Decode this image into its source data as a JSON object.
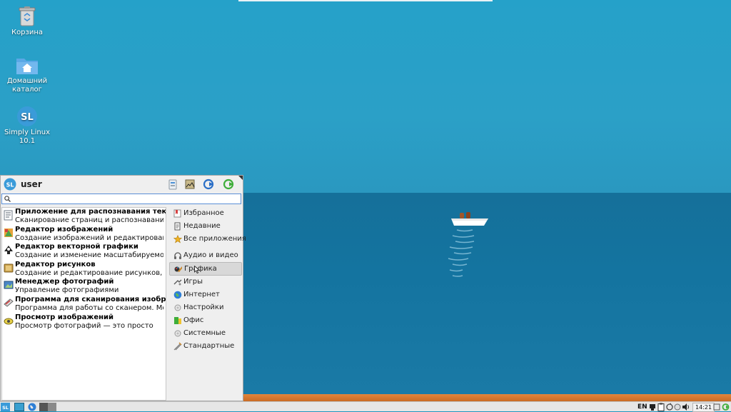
{
  "desktop": {
    "icons": [
      {
        "label": "Корзина"
      },
      {
        "label": "Домашний каталог"
      },
      {
        "label": "Simply Linux 10.1"
      }
    ]
  },
  "menu": {
    "username": "user",
    "search": {
      "value": "",
      "placeholder": ""
    },
    "apps": [
      {
        "title": "Приложение для распознавания текста",
        "desc": "Сканирование страниц и распознавание т..."
      },
      {
        "title": "Редактор изображений",
        "desc": "Создание изображений и редактировани..."
      },
      {
        "title": "Редактор векторной графики",
        "desc": "Создание и изменение масштабируемой в..."
      },
      {
        "title": "Редактор рисунков",
        "desc": "Создание и редактирование рисунков, бл..."
      },
      {
        "title": "Менеджер фотографий",
        "desc": "Управление фотографиями"
      },
      {
        "title": "Программа для сканирования изобра...",
        "desc": "Программа для работы со сканером. Мож..."
      },
      {
        "title": "Просмотр изображений",
        "desc": "Просмотр фотографий — это просто"
      }
    ],
    "categories": [
      {
        "label": "Избранное"
      },
      {
        "label": "Недавние"
      },
      {
        "label": "Все приложения"
      },
      {
        "label": "Аудио и видео"
      },
      {
        "label": "Графика"
      },
      {
        "label": "Игры"
      },
      {
        "label": "Интернет"
      },
      {
        "label": "Настройки"
      },
      {
        "label": "Офис"
      },
      {
        "label": "Системные"
      },
      {
        "label": "Стандартные"
      }
    ],
    "active_category": "Графика"
  },
  "taskbar": {
    "language": "EN",
    "clock": "14:21"
  },
  "colors": {
    "sky": "#25a1c9",
    "sea": "#15709a",
    "sand": "#e2853a",
    "accent": "#2a8fd1",
    "selection_green": "#3fae3a"
  }
}
